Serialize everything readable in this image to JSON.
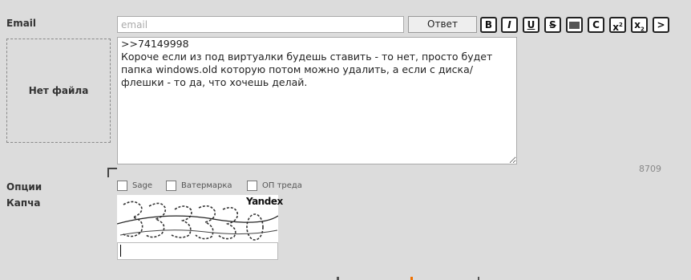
{
  "labels": {
    "email": "Email",
    "options": "Опции",
    "captcha": "Капча"
  },
  "email_field": {
    "placeholder": "email",
    "value": ""
  },
  "reply_button": "Ответ",
  "format_buttons": [
    {
      "name": "bold",
      "glyph": "B"
    },
    {
      "name": "italic",
      "glyph": "I"
    },
    {
      "name": "underline",
      "glyph": "U"
    },
    {
      "name": "strike",
      "glyph": "S"
    },
    {
      "name": "spoiler",
      "glyph": ""
    },
    {
      "name": "code",
      "glyph": "C"
    },
    {
      "name": "superscript",
      "glyph": "x",
      "mark": "2"
    },
    {
      "name": "subscript",
      "glyph": "x",
      "mark": "2"
    },
    {
      "name": "quote",
      "glyph": ">"
    }
  ],
  "file_drop": "Нет файла",
  "comment": {
    "text": ">>74149998\nКороче если из под виртуалки будешь ставить - то нет, просто будет папка windows.old которую потом можно удалить, а если с диска/флешки - то да, что хочешь делай."
  },
  "char_counter": "8709",
  "options": [
    {
      "label": "Sage",
      "checked": false
    },
    {
      "label": "Ватермарка",
      "checked": false
    },
    {
      "label": "ОП треда",
      "checked": false
    }
  ],
  "captcha": {
    "brand": "Yandex",
    "answer": ""
  },
  "colors": {
    "page_bg": "#dcdcdc",
    "yandex_red": "#d00000",
    "bottom_accent": "#f07000"
  }
}
